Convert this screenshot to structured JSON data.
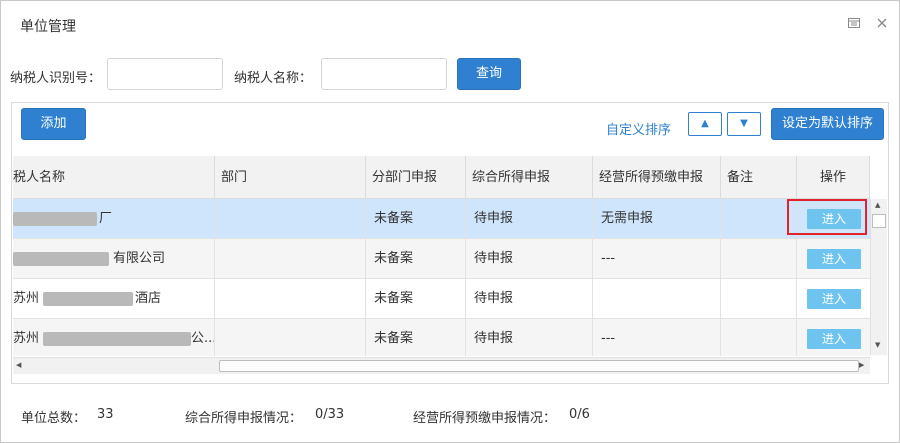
{
  "window": {
    "title": "单位管理"
  },
  "search": {
    "taxpayer_id_label": "纳税人识别号：",
    "taxpayer_id_value": "",
    "taxpayer_name_label": "纳税人名称：",
    "taxpayer_name_value": "",
    "query_label": "查询"
  },
  "toolbar": {
    "add_label": "添加",
    "custom_sort_label": "自定义排序",
    "up_glyph": "▲",
    "down_glyph": "▼",
    "set_default_label": "设定为默认排序"
  },
  "table": {
    "columns": [
      "税人名称",
      "部门",
      "分部门申报",
      "综合所得申报",
      "经营所得预缴申报",
      "备注",
      "操作"
    ],
    "rows": [
      {
        "name": "",
        "name_suffix": "厂",
        "dept": "",
        "branch": "未备案",
        "comprehensive": "待申报",
        "business": "无需申报",
        "remark": "",
        "action": "进入"
      },
      {
        "name": "",
        "name_suffix": "有限公司",
        "dept": "",
        "branch": "未备案",
        "comprehensive": "待申报",
        "business": "---",
        "remark": "",
        "action": "进入"
      },
      {
        "name": "苏州",
        "name_suffix": "酒店",
        "dept": "",
        "branch": "未备案",
        "comprehensive": "待申报",
        "business": "",
        "remark": "",
        "action": "进入"
      },
      {
        "name": "苏州",
        "name_suffix": "公...",
        "dept": "",
        "branch": "未备案",
        "comprehensive": "待申报",
        "business": "---",
        "remark": "",
        "action": "进入"
      }
    ]
  },
  "footer": {
    "total_label": "单位总数：",
    "total_value": "33",
    "comprehensive_label": "综合所得申报情况：",
    "comprehensive_value": "0/33",
    "business_label": "经营所得预缴申报情况：",
    "business_value": "0/6"
  },
  "colors": {
    "primary": "#2f80d1",
    "enter_button": "#6ec3ef",
    "selected_row": "#cfe5fb",
    "highlight_box": "#e0242b"
  },
  "icons": {
    "maximize": "maximize-icon",
    "close": "close-icon"
  }
}
